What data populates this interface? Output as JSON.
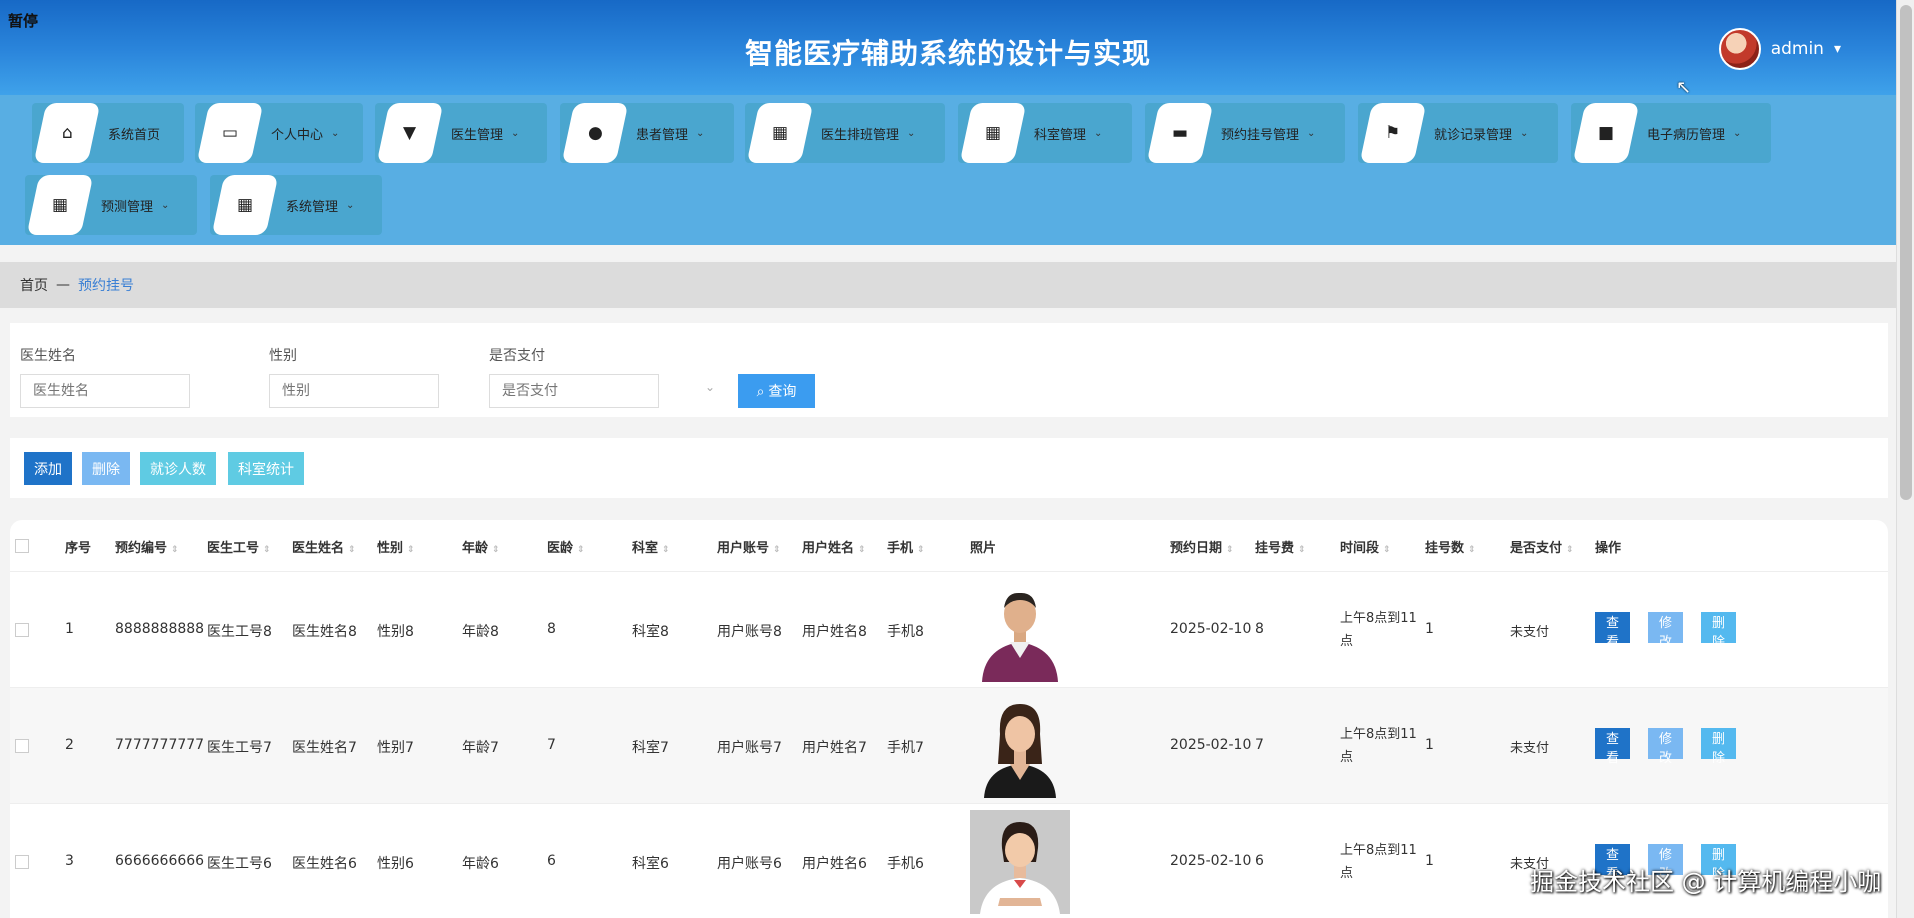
{
  "overlay": {
    "paused": "暂停"
  },
  "header": {
    "title": "智能医疗辅助系统的设计与实现",
    "user": "admin",
    "caret": "▾"
  },
  "nav": [
    {
      "label": "系统首页",
      "icon": "home-icon",
      "glyph": "⌂",
      "caret": ""
    },
    {
      "label": "个人中心",
      "icon": "card-icon",
      "glyph": "▭",
      "caret": "⌄"
    },
    {
      "label": "医生管理",
      "icon": "stamp-icon",
      "glyph": "▼",
      "caret": "⌄"
    },
    {
      "label": "患者管理",
      "icon": "pin-icon",
      "glyph": "●",
      "caret": "⌄"
    },
    {
      "label": "医生排班管理",
      "icon": "grid-icon",
      "glyph": "▦",
      "caret": "⌄"
    },
    {
      "label": "科室管理",
      "icon": "grid-icon",
      "glyph": "▦",
      "caret": "⌄"
    },
    {
      "label": "预约挂号管理",
      "icon": "message-icon",
      "glyph": "▬",
      "caret": "⌄"
    },
    {
      "label": "就诊记录管理",
      "icon": "flag-icon",
      "glyph": "⚑",
      "caret": "⌄"
    },
    {
      "label": "电子病历管理",
      "icon": "monitor-icon",
      "glyph": "■",
      "caret": "⌄"
    },
    {
      "label": "预测管理",
      "icon": "grid-icon",
      "glyph": "▦",
      "caret": "⌄"
    },
    {
      "label": "系统管理",
      "icon": "grid-icon",
      "glyph": "▦",
      "caret": "⌄"
    }
  ],
  "breadcrumb": {
    "home": "首页",
    "sep": "—",
    "current": "预约挂号"
  },
  "filter": {
    "doctor_name_label": "医生姓名",
    "doctor_name_placeholder": "医生姓名",
    "gender_label": "性别",
    "gender_placeholder": "性别",
    "paid_label": "是否支付",
    "paid_placeholder": "是否支付",
    "query_label": "查询"
  },
  "actions": {
    "add": "添加",
    "delete": "删除",
    "visit_count": "就诊人数",
    "dept_stats": "科室统计"
  },
  "table": {
    "columns": [
      "序号",
      "预约编号",
      "医生工号",
      "医生姓名",
      "性别",
      "年龄",
      "医龄",
      "科室",
      "用户账号",
      "用户姓名",
      "手机",
      "照片",
      "预约日期",
      "挂号费",
      "时间段",
      "挂号数",
      "是否支付",
      "操作"
    ],
    "rows": [
      {
        "idx": "1",
        "appt_no": "8888888888",
        "doc_id": "医生工号8",
        "doc_name": "医生姓名8",
        "gender": "性别8",
        "age": "年龄8",
        "years": "8",
        "dept": "科室8",
        "account": "用户账号8",
        "user_name": "用户姓名8",
        "phone": "手机8",
        "date": "2025-02-10",
        "fee": "8",
        "period": "上午8点到11点",
        "count": "1",
        "paid": "未支付"
      },
      {
        "idx": "2",
        "appt_no": "7777777777",
        "doc_id": "医生工号7",
        "doc_name": "医生姓名7",
        "gender": "性别7",
        "age": "年龄7",
        "years": "7",
        "dept": "科室7",
        "account": "用户账号7",
        "user_name": "用户姓名7",
        "phone": "手机7",
        "date": "2025-02-10",
        "fee": "7",
        "period": "上午8点到11点",
        "count": "1",
        "paid": "未支付"
      },
      {
        "idx": "3",
        "appt_no": "6666666666",
        "doc_id": "医生工号6",
        "doc_name": "医生姓名6",
        "gender": "性别6",
        "age": "年龄6",
        "years": "6",
        "dept": "科室6",
        "account": "用户账号6",
        "user_name": "用户姓名6",
        "phone": "手机6",
        "date": "2025-02-10",
        "fee": "6",
        "period": "上午8点到11点",
        "count": "1",
        "paid": "未支付"
      }
    ],
    "ops": {
      "view": "查看",
      "edit": "修改",
      "delete": "删除"
    }
  },
  "watermark": "掘金技术社区 @ 计算机编程小咖",
  "colors": {
    "header": "#2b86dc",
    "nav": "#58aee3",
    "primary": "#1f73c8",
    "accent": "#3b9cf0",
    "cyan": "#54c8e8"
  }
}
